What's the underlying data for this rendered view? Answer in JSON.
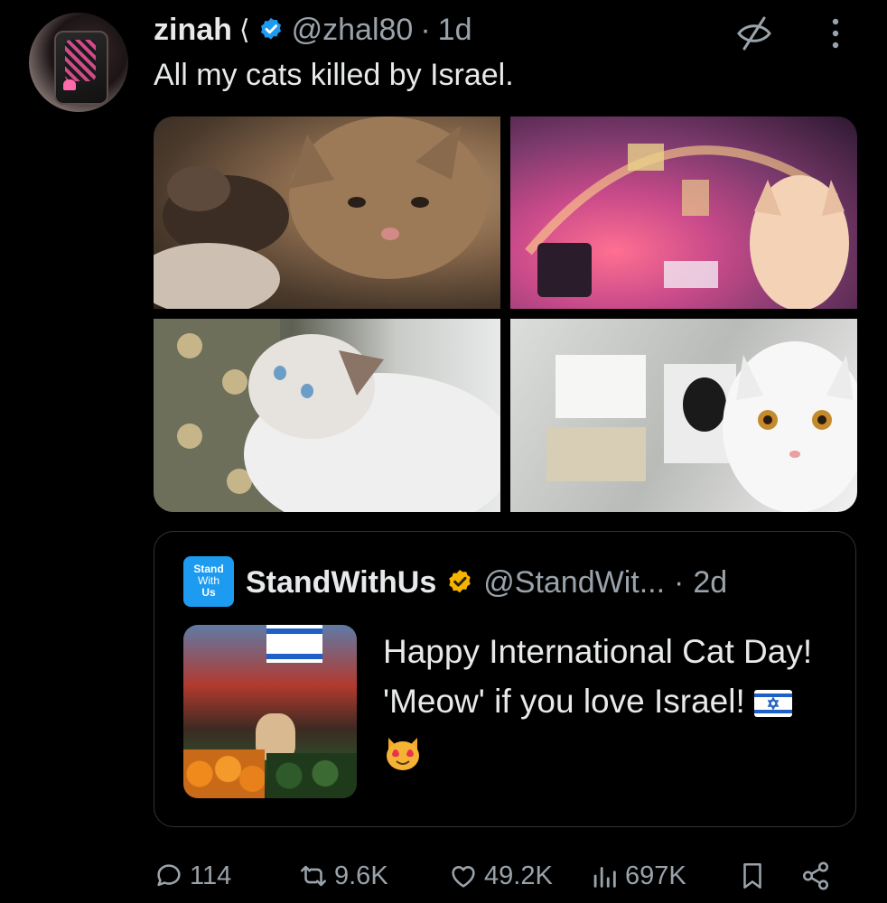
{
  "tweet": {
    "author_name": "zinah",
    "author_handle": "@zhal80",
    "separator": "·",
    "time": "1d",
    "text": "All my cats killed by Israel.",
    "images": [
      "cat-photo-1",
      "cat-photo-2",
      "cat-photo-3",
      "cat-photo-4"
    ]
  },
  "quoted": {
    "logo_lines": [
      "Stand",
      "With",
      "Us"
    ],
    "author_name": "StandWithUs",
    "author_handle": "@StandWit...",
    "separator": "·",
    "time": "2d",
    "text": "Happy International Cat Day! 'Meow' if you love Israel!"
  },
  "actions": {
    "replies": "114",
    "reposts": "9.6K",
    "likes": "49.2K",
    "views": "697K"
  },
  "colors": {
    "background": "#000000",
    "text": "#e7e9ea",
    "muted": "#9aa3ab",
    "accent": "#1d9bf0",
    "gold": "#f4b400",
    "border": "#2f3336"
  },
  "icons": [
    "verified-badge-icon",
    "mute-icon",
    "more-icon",
    "gold-verified-badge-icon",
    "reply-icon",
    "repost-icon",
    "like-icon",
    "views-icon",
    "bookmark-icon",
    "share-icon",
    "israel-flag-emoji-icon",
    "heart-eyes-cat-emoji-icon"
  ]
}
